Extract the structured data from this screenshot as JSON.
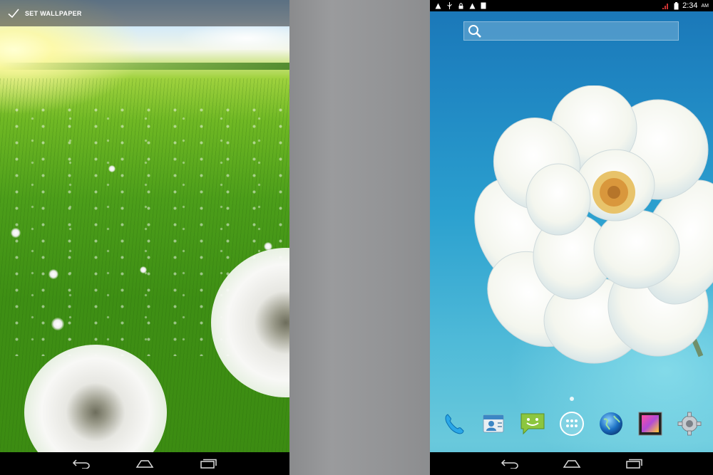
{
  "left": {
    "top_action": {
      "label": "SET WALLPAPER",
      "icon": "check-icon"
    },
    "navbar": [
      "back-icon",
      "home-icon",
      "recent-apps-icon"
    ]
  },
  "right": {
    "status_bar": {
      "left_icons": [
        "warning-icon",
        "usb-icon",
        "lock-icon",
        "warning-icon",
        "sd-card-icon"
      ],
      "right_icons": [
        "signal-icon",
        "battery-icon"
      ],
      "time": "2:34",
      "ampm": "AM"
    },
    "search": {
      "icon": "search-icon"
    },
    "dock": [
      "phone-icon",
      "contacts-icon",
      "messaging-icon",
      "app-drawer-icon",
      "browser-icon",
      "gallery-icon",
      "settings-icon"
    ],
    "navbar": [
      "back-icon",
      "home-icon",
      "recent-apps-icon"
    ]
  },
  "colors": {
    "topbar_bg": "#464646",
    "navbar_bg": "#000000",
    "gap_gray": "#939496",
    "sky_blue": "#1f86c2"
  }
}
